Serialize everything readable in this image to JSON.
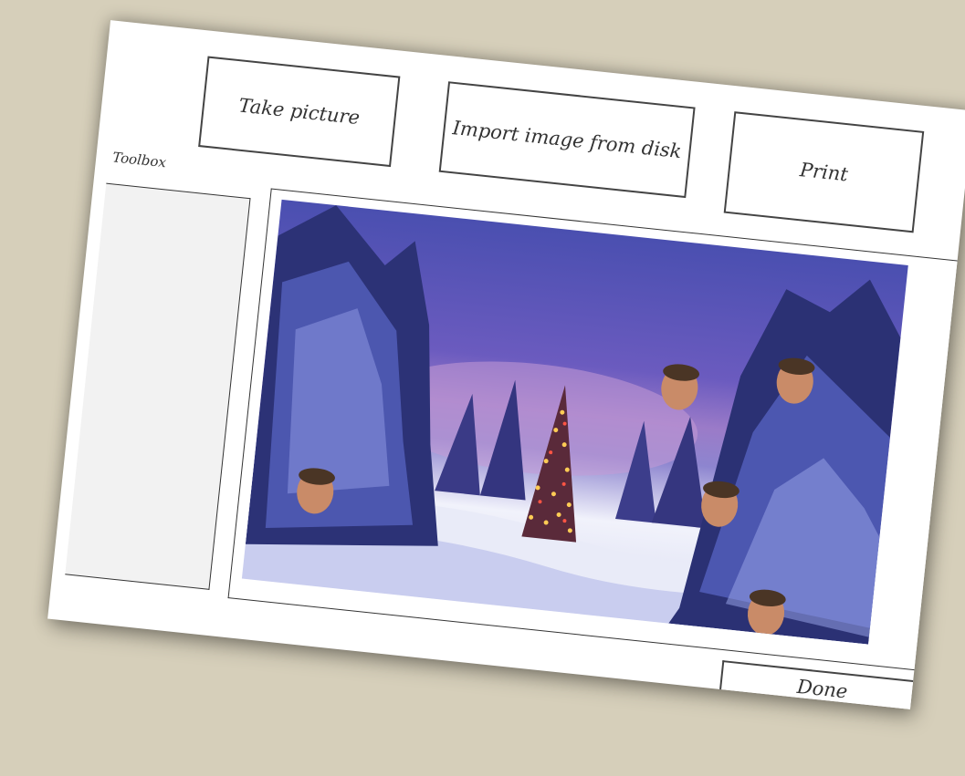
{
  "toolbar": {
    "take_picture_label": "Take picture",
    "import_label": "Import image from disk",
    "print_label": "Print"
  },
  "toolbox": {
    "label": "Toolbox"
  },
  "footer": {
    "done_label": "Done"
  }
}
